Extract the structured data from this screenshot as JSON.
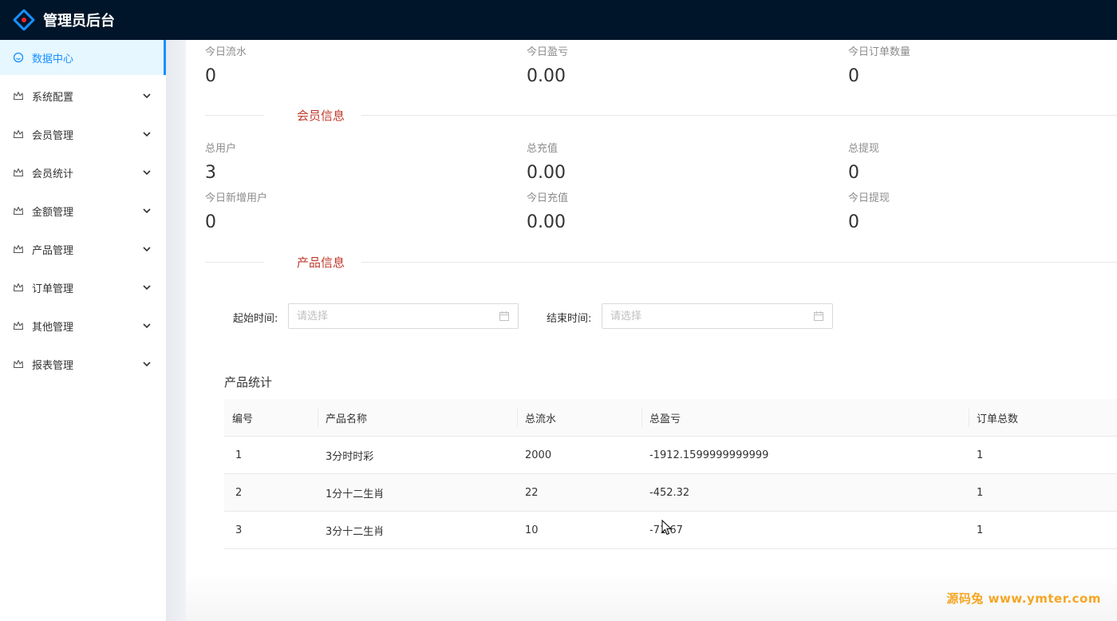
{
  "header": {
    "title": "管理员后台"
  },
  "sidebar": {
    "items": [
      {
        "label": "数据中心",
        "icon": "dashboard-icon",
        "active": true
      },
      {
        "label": "系统配置",
        "icon": "crown-icon"
      },
      {
        "label": "会员管理",
        "icon": "crown-icon"
      },
      {
        "label": "会员统计",
        "icon": "crown-icon"
      },
      {
        "label": "金额管理",
        "icon": "crown-icon"
      },
      {
        "label": "产品管理",
        "icon": "crown-icon"
      },
      {
        "label": "订单管理",
        "icon": "crown-icon"
      },
      {
        "label": "其他管理",
        "icon": "crown-icon"
      },
      {
        "label": "报表管理",
        "icon": "crown-icon"
      }
    ]
  },
  "today": {
    "flow": {
      "label": "今日流水",
      "value": "0"
    },
    "profit": {
      "label": "今日盈亏",
      "value": "0.00"
    },
    "orders": {
      "label": "今日订单数量",
      "value": "0"
    }
  },
  "member_section": "会员信息",
  "member": {
    "total_users": {
      "label": "总用户",
      "value": "3"
    },
    "total_recharge": {
      "label": "总充值",
      "value": "0.00"
    },
    "total_withdraw": {
      "label": "总提现",
      "value": "0"
    },
    "new_users": {
      "label": "今日新增用户",
      "value": "0"
    },
    "today_recharge": {
      "label": "今日充值",
      "value": "0.00"
    },
    "today_withdraw": {
      "label": "今日提现",
      "value": "0"
    }
  },
  "product_section": "产品信息",
  "filters": {
    "start_label": "起始时间:",
    "start_placeholder": "请选择",
    "end_label": "结束时间:",
    "end_placeholder": "请选择"
  },
  "product_stats": {
    "title": "产品统计",
    "columns": [
      "编号",
      "产品名称",
      "总流水",
      "总盈亏",
      "订单总数"
    ],
    "rows": [
      [
        "1",
        "3分时时彩",
        "2000",
        "-1912.1599999999999",
        "1"
      ],
      [
        "2",
        "1分十二生肖",
        "22",
        "-452.32",
        "1"
      ],
      [
        "3",
        "3分十二生肖",
        "10",
        "-71.67",
        "1"
      ]
    ]
  },
  "watermark": "源码兔 www.ymter.com",
  "colors": {
    "header_bg": "#001529",
    "accent": "#1890ff",
    "section_title": "#c0392b"
  }
}
